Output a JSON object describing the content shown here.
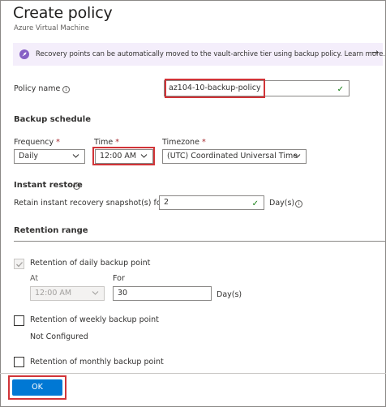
{
  "header": {
    "title": "Create policy",
    "subtitle": "Azure Virtual Machine"
  },
  "banner": {
    "text": "Recovery points can be automatically moved to the vault-archive tier using backup policy. Learn more.",
    "arrow": "→",
    "icon": "rocket-icon",
    "bg_color": "#f4eefb"
  },
  "policy": {
    "label": "Policy name",
    "value": "az104-10-backup-policy"
  },
  "backup_schedule": {
    "heading": "Backup schedule",
    "frequency": {
      "label": "Frequency",
      "required": "*",
      "value": "Daily"
    },
    "time": {
      "label": "Time",
      "required": "*",
      "value": "12:00 AM"
    },
    "timezone": {
      "label": "Timezone",
      "required": "*",
      "value": "(UTC) Coordinated Universal Time"
    }
  },
  "instant_restore": {
    "heading": "Instant restore",
    "label": "Retain instant recovery snapshot(s) for",
    "value": "2",
    "unit": "Day(s)"
  },
  "retention": {
    "heading": "Retention range",
    "daily": {
      "label": "Retention of daily backup point",
      "checked": true,
      "at_label": "At",
      "at_value": "12:00 AM",
      "for_label": "For",
      "for_value": "30",
      "unit": "Day(s)"
    },
    "weekly": {
      "label": "Retention of weekly backup point",
      "checked": false,
      "status": "Not Configured"
    },
    "monthly": {
      "label": "Retention of monthly backup point",
      "checked": false
    }
  },
  "footer": {
    "ok_label": "OK"
  },
  "colors": {
    "accent": "#0078d4",
    "highlight": "#d13438",
    "valid": "#107c10"
  }
}
